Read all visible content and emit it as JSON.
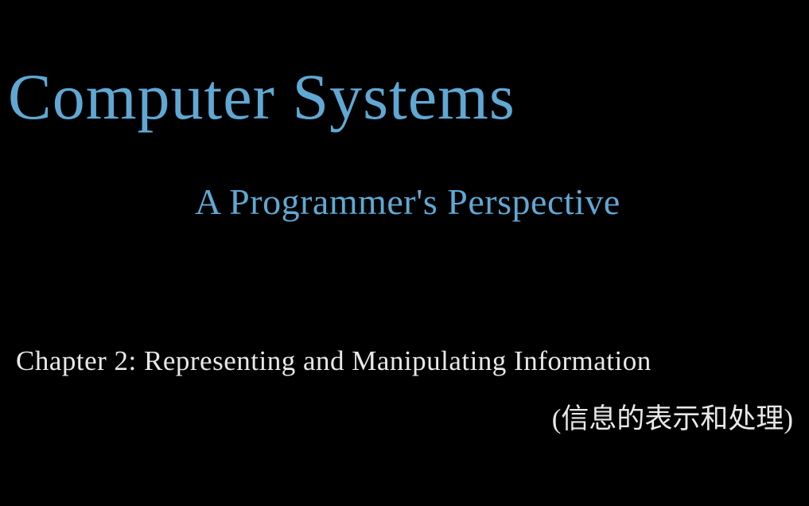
{
  "title": {
    "main": "Computer Systems",
    "subtitle": "A Programmer's Perspective"
  },
  "chapter": {
    "english": "Chapter 2: Representing and Manipulating Information",
    "chinese": "(信息的表示和处理)"
  }
}
